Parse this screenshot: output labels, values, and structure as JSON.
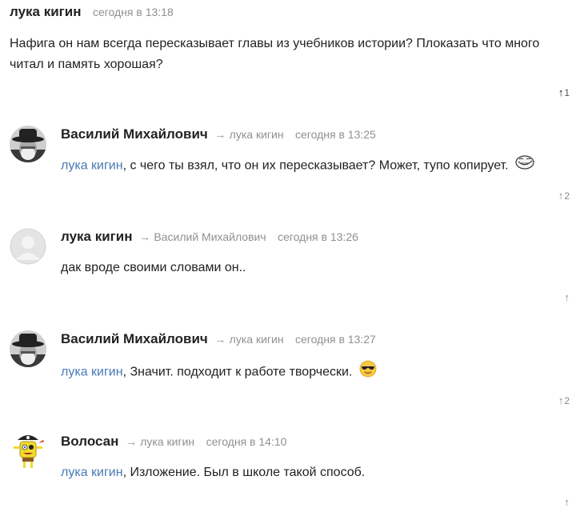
{
  "comments": [
    {
      "author": "лука кигин",
      "time": "сегодня в 13:18",
      "text": "Нафига он нам всегда пересказывает главы из учебников истории? Плоказать что много читал и память хорошая?",
      "votes": "1"
    },
    {
      "author": "Василий Михайлович",
      "reply_to": "лука кигин",
      "time": "сегодня в 13:25",
      "mention": "лука кигин",
      "text": ", с чего ты взял, что он их пересказывает? Может, тупо копирует.",
      "emoji": "trollface-emoji",
      "votes": "2"
    },
    {
      "author": "лука кигин",
      "reply_to": "Василий Михайлович",
      "time": "сегодня в 13:26",
      "text": "дак вроде своими словами он..",
      "votes": ""
    },
    {
      "author": "Василий Михайлович",
      "reply_to": "лука кигин",
      "time": "сегодня в 13:27",
      "mention": "лука кигин",
      "text": ", Значит. подходит к работе творчески.",
      "emoji": "sunglasses-emoji",
      "votes": "2"
    },
    {
      "author": "Волосан",
      "reply_to": "лука кигин",
      "time": "сегодня в 14:10",
      "mention": "лука кигин",
      "text": ", Изложение. Был в школе такой способ.",
      "votes": ""
    }
  ],
  "arrow_glyph": "→",
  "colors": {
    "link": "#4a7ab6",
    "muted": "#909090",
    "text": "#222222"
  }
}
